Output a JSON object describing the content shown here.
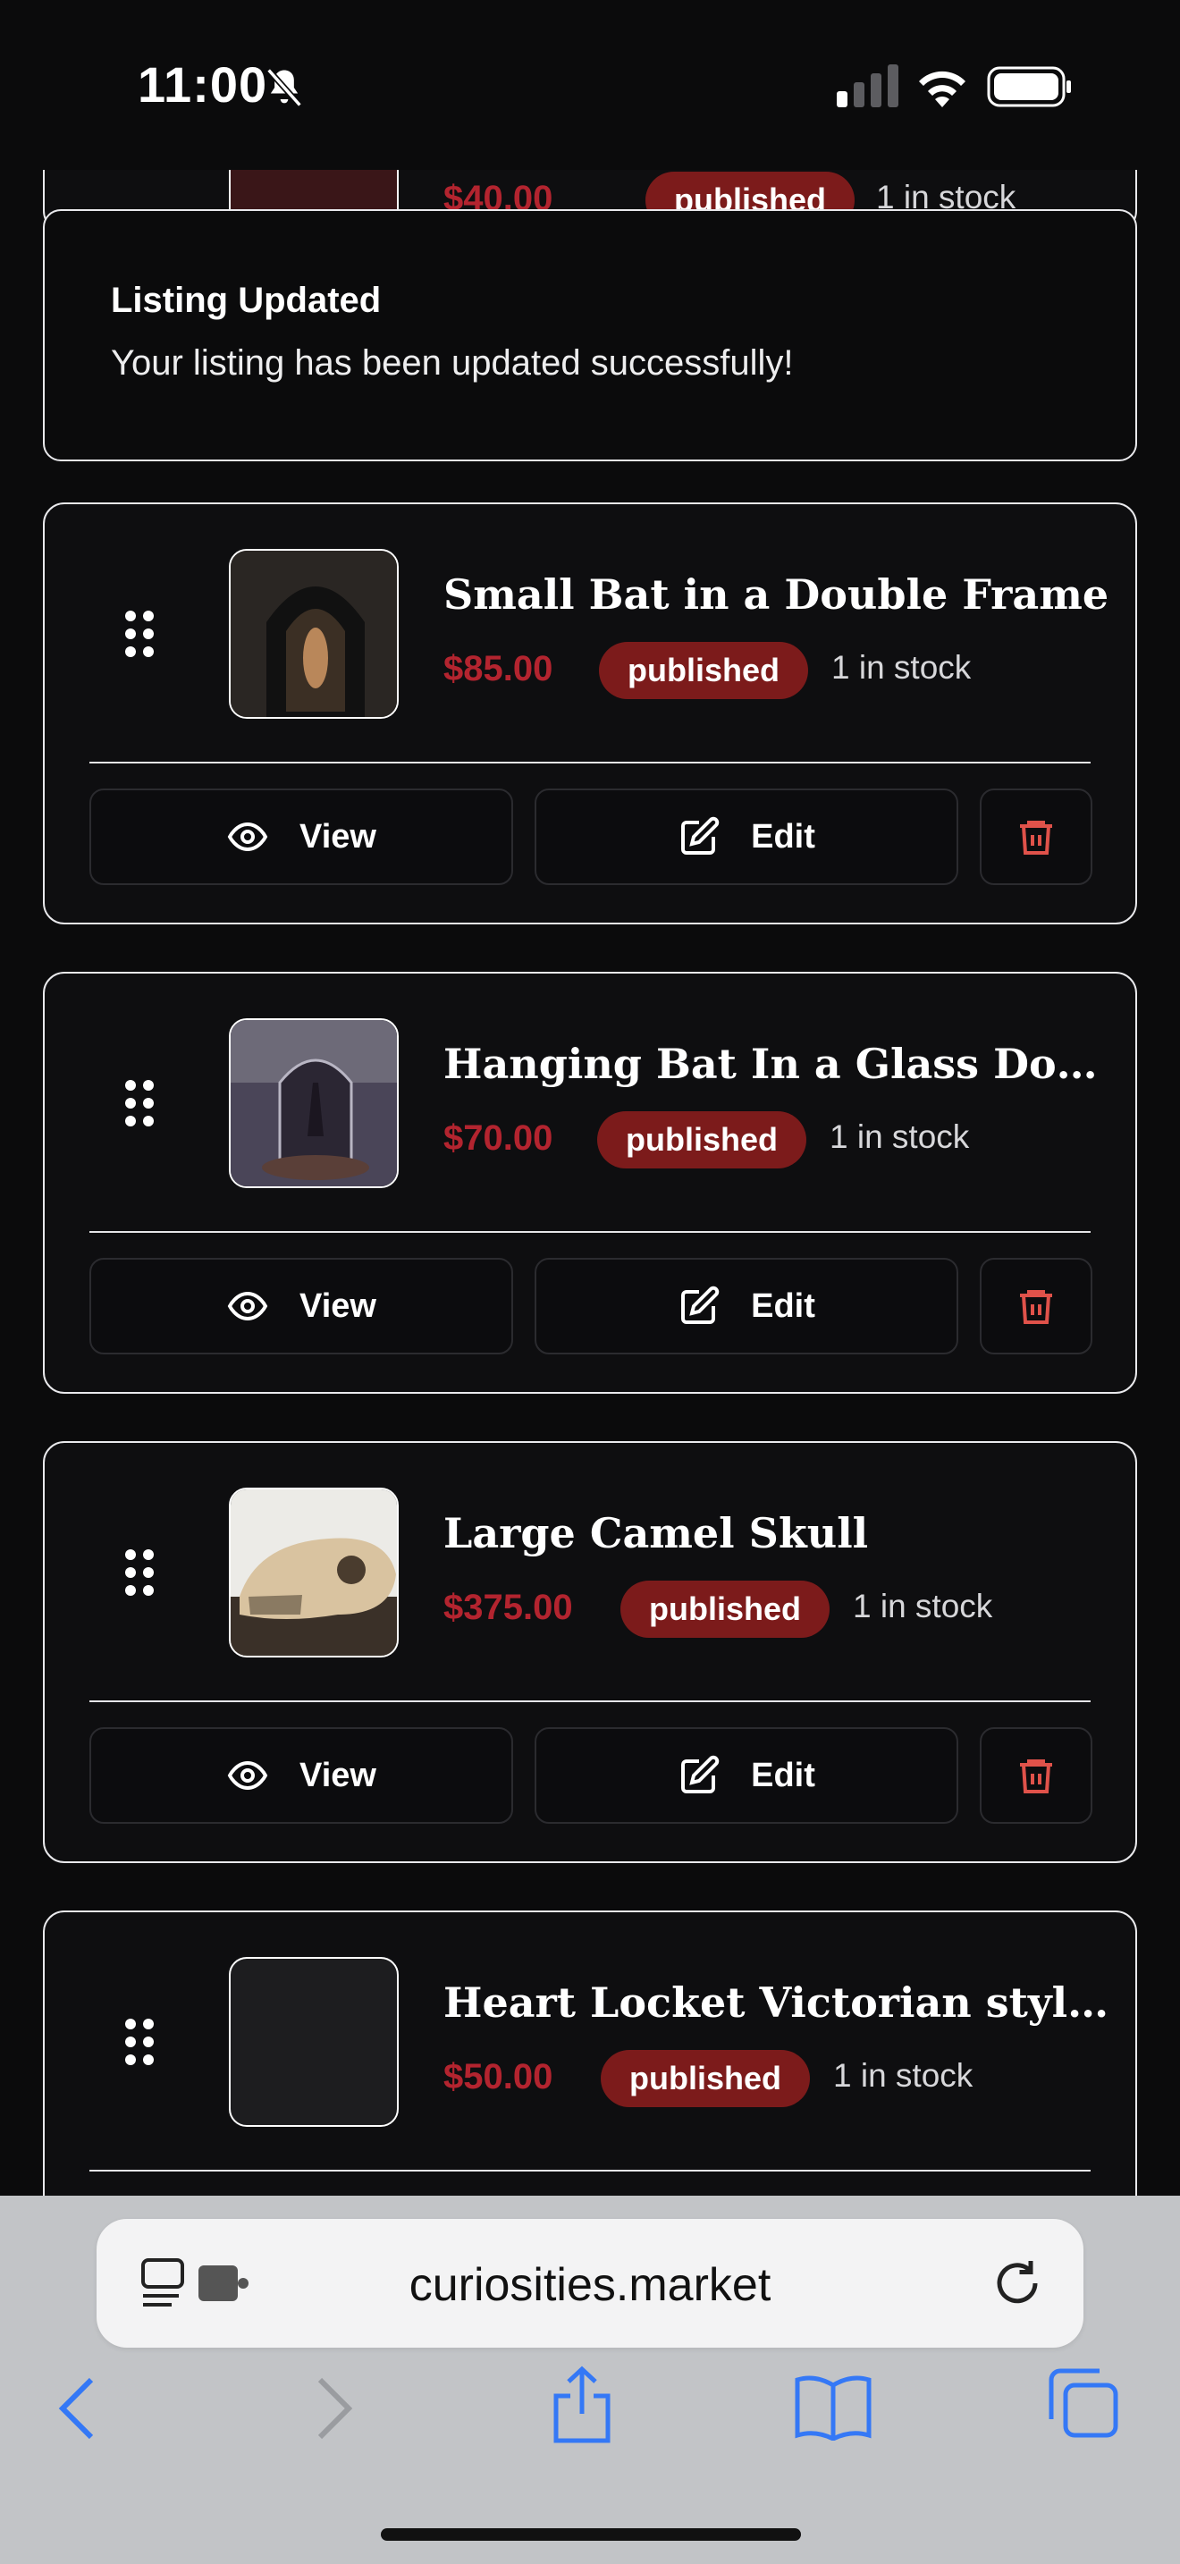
{
  "status_bar": {
    "time": "11:00"
  },
  "toast": {
    "title": "Listing Updated",
    "message": "Your listing has been updated successfully!"
  },
  "top_partial": {
    "price": "$40.00",
    "status": "published",
    "stock": "1 in stock"
  },
  "listings": [
    {
      "title": "Small Bat in a Double Frame",
      "price": "$85.00",
      "status": "published",
      "stock": "1 in stock"
    },
    {
      "title": "Hanging Bat In a Glass Dome -...",
      "price": "$70.00",
      "status": "published",
      "stock": "1 in stock"
    },
    {
      "title": "Large Camel Skull",
      "price": "$375.00",
      "status": "published",
      "stock": "1 in stock"
    },
    {
      "title": "Heart Locket Victorian style - ...",
      "price": "$50.00",
      "status": "published",
      "stock": "1 in stock"
    }
  ],
  "actions": {
    "view": "View",
    "edit": "Edit"
  },
  "browser": {
    "url": "curiosities.market"
  },
  "colors": {
    "price": "#b3242f",
    "badge": "#7c1b1b",
    "delete": "#e0524a",
    "safari_blue": "#3478f6"
  }
}
